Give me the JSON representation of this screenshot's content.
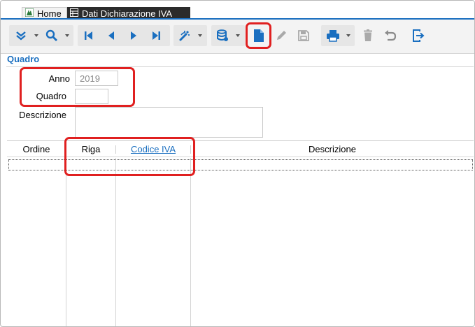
{
  "tabs": [
    {
      "label": "Home",
      "icon": "home-app-icon"
    },
    {
      "label": "Dati Dichiarazione IVA",
      "icon": "table-doc-icon"
    }
  ],
  "toolbar": {
    "buttons": [
      "expand-icon",
      "search-icon",
      "first-record-icon",
      "previous-record-icon",
      "next-record-icon",
      "last-record-icon",
      "wand-icon",
      "database-icon",
      "new-document-icon",
      "edit-icon",
      "save-icon",
      "print-icon",
      "delete-icon",
      "undo-icon",
      "exit-icon"
    ]
  },
  "section": {
    "title": "Quadro"
  },
  "form": {
    "anno_label": "Anno",
    "anno_value": "2019",
    "quadro_label": "Quadro",
    "quadro_value": "",
    "descrizione_label": "Descrizione",
    "descrizione_value": ""
  },
  "grid": {
    "columns": [
      "Ordine",
      "Riga",
      "Codice IVA",
      "Descrizione"
    ]
  },
  "colors": {
    "accent": "#1a6fc0",
    "highlight": "#e02020"
  }
}
